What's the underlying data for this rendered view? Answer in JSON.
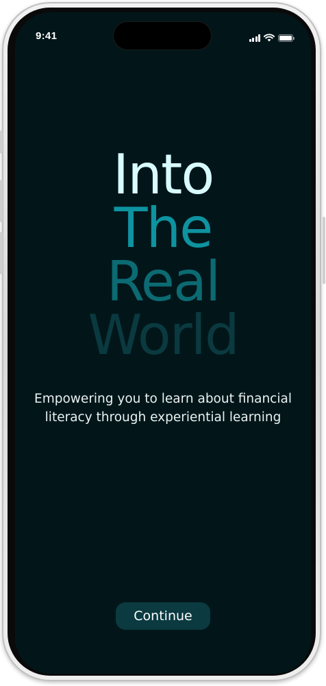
{
  "status_bar": {
    "time": "9:41",
    "icons": [
      "signal-icon",
      "wifi-icon",
      "battery-icon"
    ]
  },
  "hero": {
    "lines": [
      "Into",
      "The",
      "Real",
      "World"
    ]
  },
  "tagline": "Empowering you to learn about financial literacy through experiential learning",
  "actions": {
    "continue_label": "Continue"
  },
  "colors": {
    "screen_background": "#02161a",
    "line_1": "#d8fbfd",
    "line_2": "#0e93a0",
    "line_3": "#0c6a72",
    "line_4": "#0a3a40",
    "button_background": "#0b3a41",
    "text": "#e9f2f2"
  }
}
